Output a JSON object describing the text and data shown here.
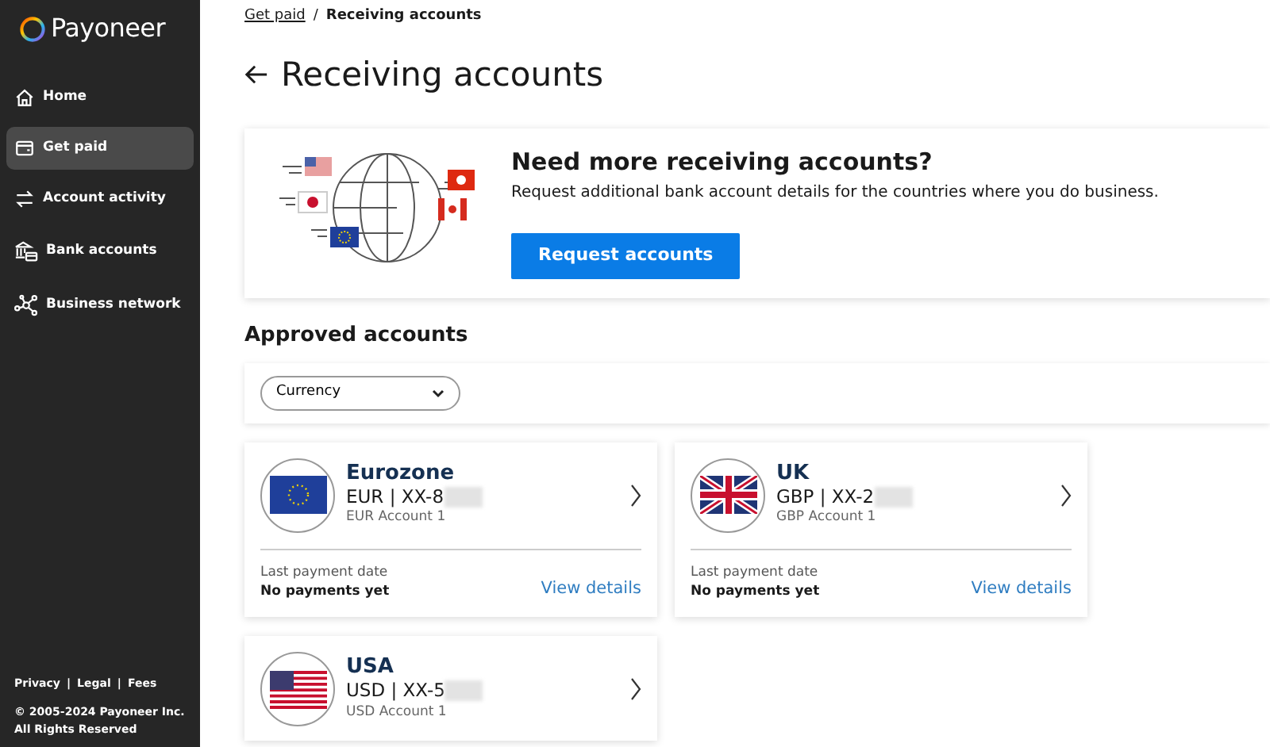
{
  "brand": {
    "name": "Payoneer"
  },
  "sidebar": {
    "items": [
      {
        "label": "Home",
        "selected": false
      },
      {
        "label": "Get paid",
        "selected": true
      },
      {
        "label": "Account activity",
        "selected": false
      },
      {
        "label": "Bank accounts",
        "selected": false
      },
      {
        "label": "Business network",
        "selected": false
      }
    ],
    "footer_links": [
      "Privacy",
      "Legal",
      "Fees"
    ],
    "footer_separator": "|",
    "copyright": "© 2005-2024 Payoneer Inc. All Rights Reserved"
  },
  "breadcrumb": [
    {
      "label": "Get paid",
      "current": false
    },
    {
      "label": "Receiving accounts",
      "current": true
    }
  ],
  "breadcrumb_separator": "/",
  "page_title": "Receiving accounts",
  "promo": {
    "title": "Need more receiving accounts?",
    "text": "Request additional bank account details for the countries where you do business.",
    "button": "Request accounts"
  },
  "section_title": "Approved accounts",
  "filter": {
    "label": "Currency"
  },
  "accounts": [
    {
      "kind": "eu",
      "region": "Eurozone",
      "number": "EUR | XX-8",
      "name": "EUR Account 1",
      "last_payment_label": "Last payment date",
      "last_payment": "No payments yet",
      "link": "View details"
    },
    {
      "kind": "gb",
      "region": "UK",
      "number": "GBP | XX-2",
      "name": "GBP Account 1",
      "last_payment_label": "Last payment date",
      "last_payment": "No payments yet",
      "link": "View details"
    },
    {
      "kind": "us",
      "region": "USA",
      "number": "USD | XX-5",
      "name": "USD Account 1"
    }
  ]
}
